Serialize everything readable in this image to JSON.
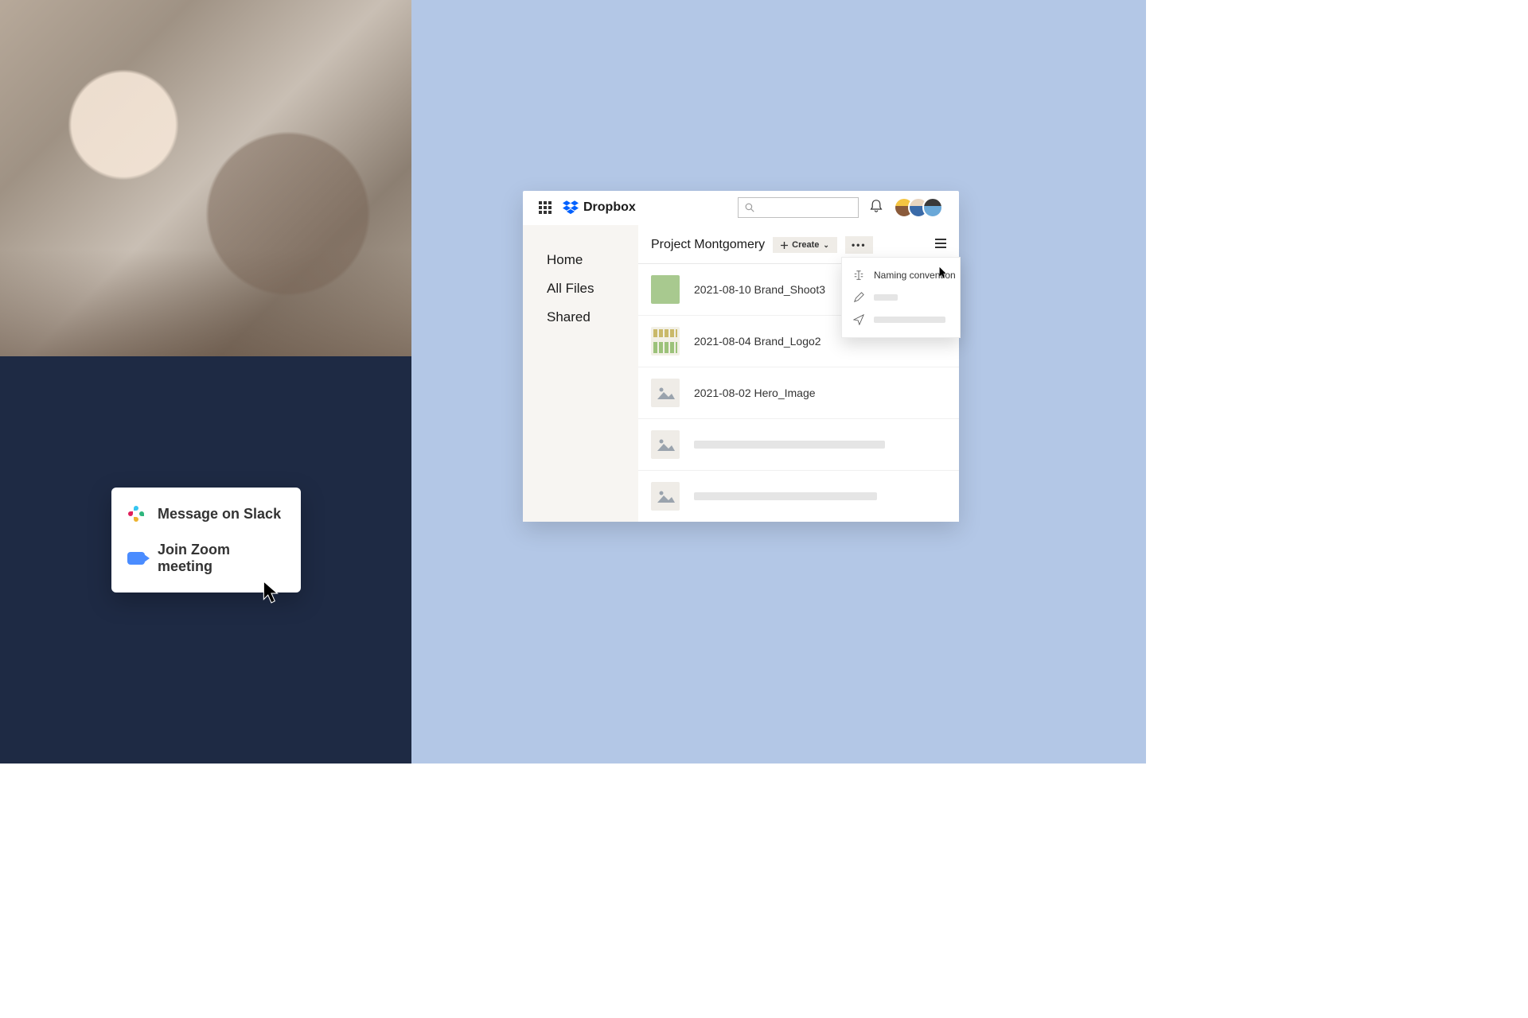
{
  "integration_card": {
    "slack_label": "Message on Slack",
    "zoom_label": "Join Zoom meeting"
  },
  "dropbox": {
    "brand": "Dropbox",
    "search_placeholder": "",
    "sidebar": {
      "home": "Home",
      "all_files": "All Files",
      "shared": "Shared"
    },
    "folder": {
      "title": "Project Montgomery",
      "create_label": "Create"
    },
    "files": {
      "f1": "2021-08-10 Brand_Shoot3",
      "f2": "2021-08-04 Brand_Logo2",
      "f3": "2021-08-02 Hero_Image"
    },
    "popover": {
      "naming_convention": "Naming convention"
    }
  }
}
